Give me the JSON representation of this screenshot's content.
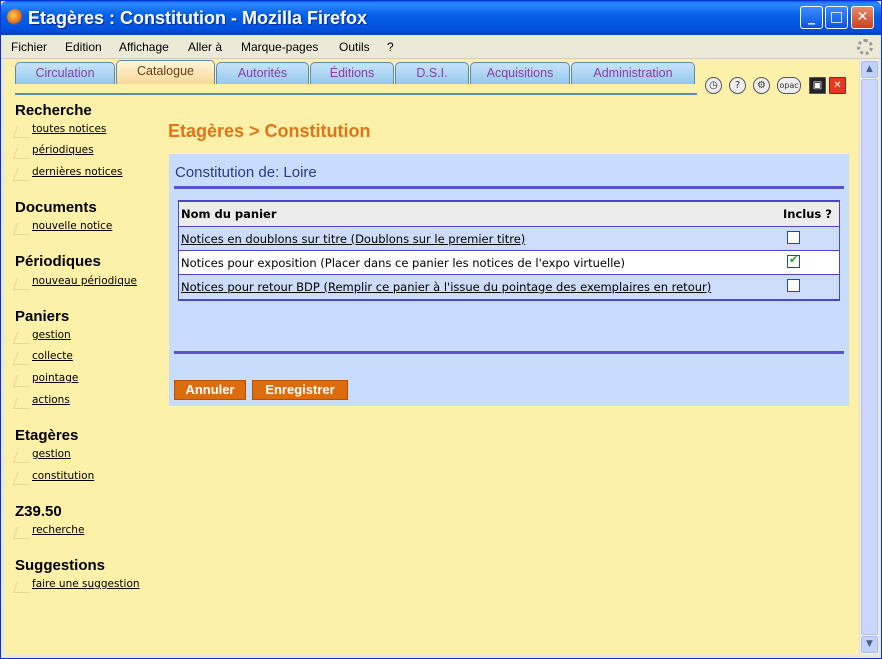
{
  "window": {
    "title": "Etagères : Constitution - Mozilla Firefox",
    "controls": {
      "minimize": "_",
      "maximize": "□",
      "close": "✕"
    }
  },
  "menubar": [
    "Fichier",
    "Edition",
    "Affichage",
    "Aller à",
    "Marque-pages",
    "Outils",
    "?"
  ],
  "tabs": [
    {
      "label": "Circulation",
      "active": false
    },
    {
      "label": "Catalogue",
      "active": true
    },
    {
      "label": "Autorités",
      "active": false
    },
    {
      "label": "Éditions",
      "active": false
    },
    {
      "label": "D.S.I.",
      "active": false
    },
    {
      "label": "Acquisitions",
      "active": false
    },
    {
      "label": "Administration",
      "active": false
    }
  ],
  "toolbar_icons": [
    "clock-icon",
    "help-icon",
    "settings-icon",
    "opac-icon",
    "save-icon",
    "close-icon"
  ],
  "toolbar": {
    "opac_label": "opac"
  },
  "sidebar": {
    "sections": [
      {
        "title": "Recherche",
        "links": [
          "toutes notices",
          "périodiques",
          "dernières notices"
        ]
      },
      {
        "title": "Documents",
        "links": [
          "nouvelle notice"
        ]
      },
      {
        "title": "Périodiques",
        "links": [
          "nouveau périodique"
        ]
      },
      {
        "title": "Paniers",
        "links": [
          "gestion",
          "collecte",
          "pointage",
          "actions"
        ]
      },
      {
        "title": "Etagères",
        "links": [
          "gestion",
          "constitution"
        ]
      },
      {
        "title": "Z39.50",
        "links": [
          "recherche"
        ]
      },
      {
        "title": "Suggestions",
        "links": [
          "faire une suggestion"
        ]
      }
    ]
  },
  "main": {
    "heading": "Etagères > Constitution",
    "panel_title": "Constitution de: Loire",
    "table": {
      "headers": {
        "name": "Nom du panier",
        "included": "Inclus ?"
      },
      "rows": [
        {
          "name": "Notices en doublons sur titre (Doublons sur le premier titre)",
          "included": false
        },
        {
          "name": "Notices pour exposition (Placer dans ce panier les notices de l'expo virtuelle)",
          "included": true
        },
        {
          "name": "Notices pour retour BDP (Remplir ce panier à l'issue du pointage des exemplaires en retour)",
          "included": false
        }
      ]
    },
    "buttons": {
      "cancel": "Annuler",
      "save": "Enregistrer"
    }
  },
  "colors": {
    "page_background": "#fdf0a8",
    "heading_orange": "#e07418",
    "panel_blue": "#c8dcfc",
    "rule_blue": "#5a50d0",
    "button_orange": "#dc6c0c",
    "titlebar_blue": "#0058e6"
  }
}
